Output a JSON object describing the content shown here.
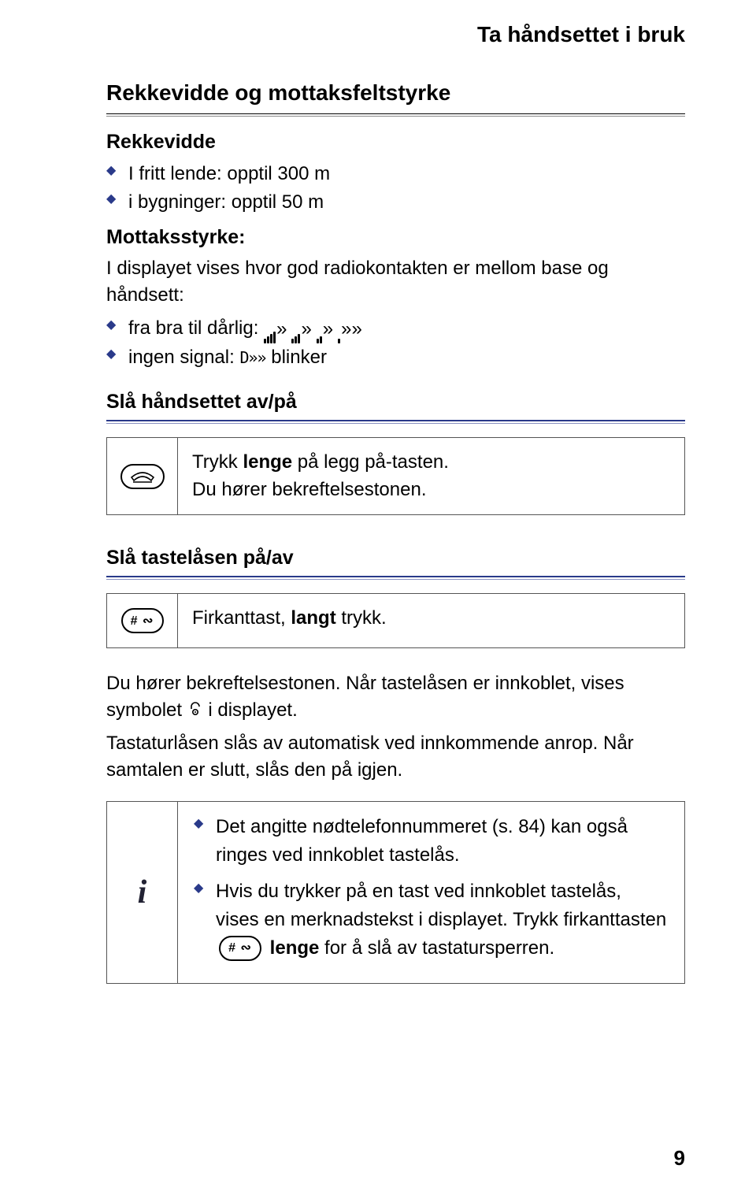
{
  "header": {
    "title": "Ta håndsettet i bruk"
  },
  "section1": {
    "heading": "Rekkevidde og mottaksfeltstyrke",
    "sub_range": "Rekkevidde",
    "range_items": [
      "I fritt lende: opptil 300 m",
      "i bygninger: opptil 50 m"
    ],
    "sub_strength": "Mottaksstyrke:",
    "strength_intro": "I displayet vises hvor god radiokontakten er mellom base og håndsett:",
    "strength_items_prefix": [
      "fra bra til dårlig:",
      "ingen signal:"
    ],
    "nosignal_glyph": "D»»",
    "blinker": "blinker",
    "sub_onoff": "Slå håndsettet av/på",
    "onoff_instruction_1": "Trykk ",
    "onoff_instruction_strong": "lenge",
    "onoff_instruction_2": " på legg på-tasten.",
    "onoff_instruction_line2": "Du hører bekreftelsestonen."
  },
  "section2": {
    "heading": "Slå tastelåsen på/av",
    "box_text_1": "Firkanttast, ",
    "box_text_strong": "langt",
    "box_text_2": " trykk.",
    "para1_a": "Du hører bekreftelsestonen. Når tastelåsen er innkoblet, vises symbolet ",
    "para1_b": " i displayet.",
    "para2": "Tastaturlåsen slås av automatisk ved innkommende anrop. Når samtalen er slutt, slås den på igjen.",
    "info_items": [
      "Det angitte nødtelefonnummeret (s. 84) kan også ringes ved innkoblet tastelås.",
      "Hvis du trykker på en tast ved innkoblet tastelås, vises en merknadstekst i displayet. Trykk firkanttasten "
    ],
    "info_item2_tail_strong": "lenge",
    "info_item2_tail": " for å slå av tastatursperren."
  },
  "hash_label": "# ∾",
  "page_number": "9"
}
